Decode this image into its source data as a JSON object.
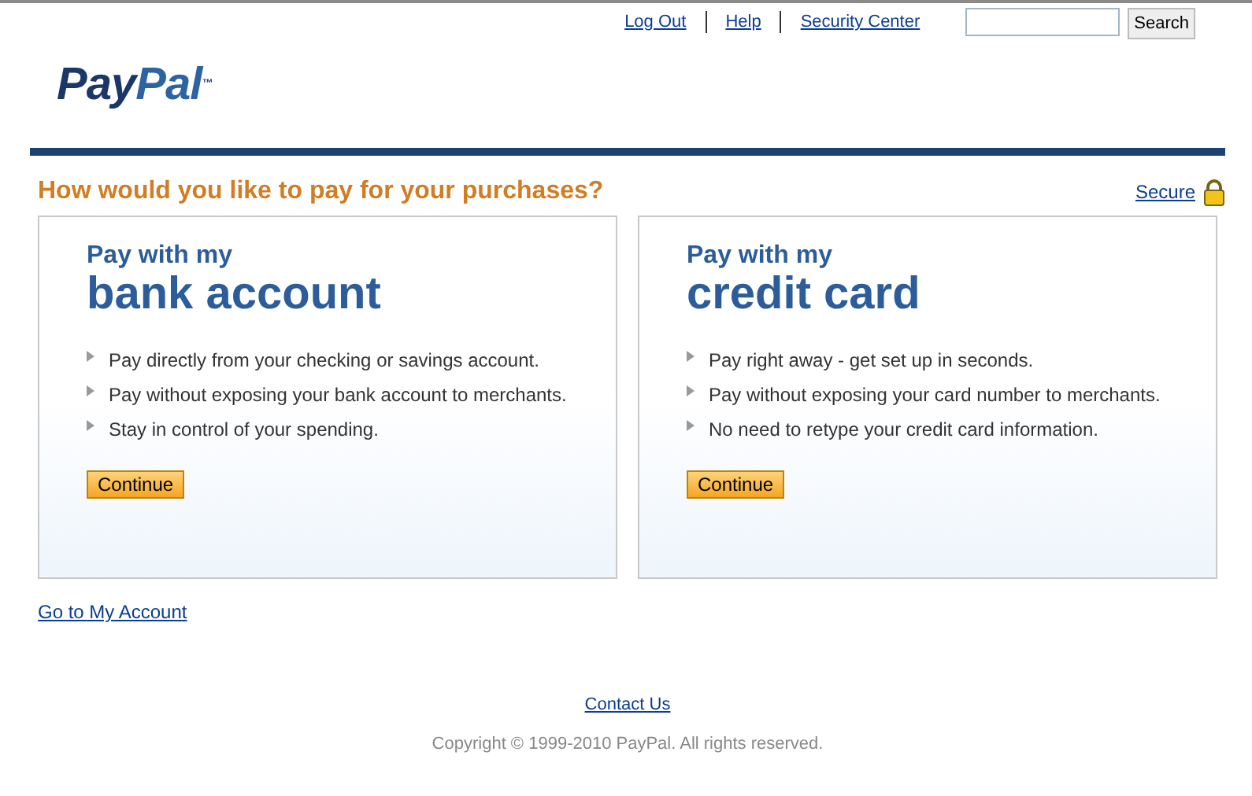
{
  "top_links": [
    "Log Out",
    "Help",
    "Security Center"
  ],
  "search": {
    "button": "Search"
  },
  "logo": {
    "parts": [
      {
        "text": "Pay",
        "color": "#1b3668"
      },
      {
        "text": "Pal",
        "color": "#2c64a3"
      }
    ],
    "mark": "™"
  },
  "heading": "How would you like to pay for your purchases?",
  "secure_link": "Secure",
  "options": [
    {
      "kicker": "Pay with my",
      "title": "bank account",
      "bullets": [
        "Pay directly from your checking or savings account.",
        "Pay without exposing your bank account to merchants.",
        "Stay in control of your spending."
      ],
      "button": "Continue"
    },
    {
      "kicker": "Pay with my",
      "title": "credit card",
      "bullets": [
        "Pay right away - get set up in seconds.",
        "Pay without exposing your card number to merchants.",
        "No need to retype your credit card information."
      ],
      "button": "Continue"
    }
  ],
  "account_link": "Go to My Account",
  "footer": {
    "link": "Contact Us",
    "copyright": "Copyright © 1999-2010 PayPal. All rights reserved."
  }
}
